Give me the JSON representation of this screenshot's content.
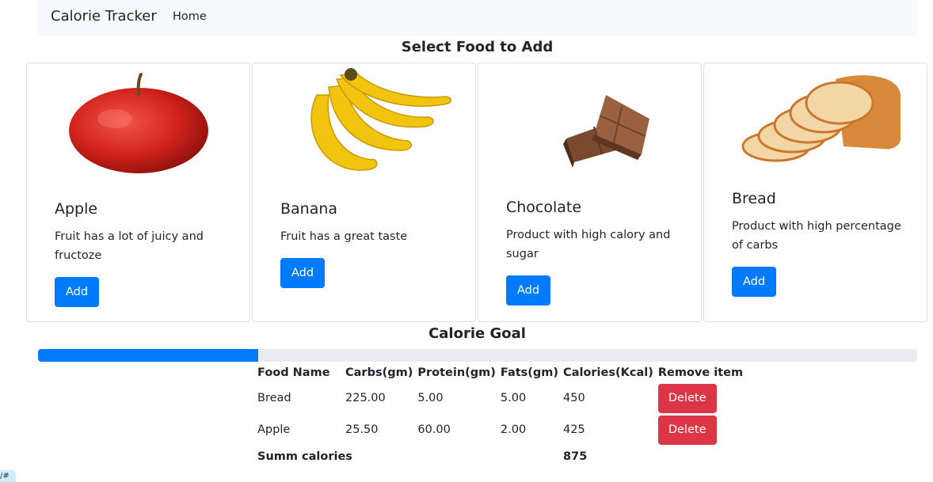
{
  "navbar": {
    "brand": "Calorie Tracker",
    "home": "Home"
  },
  "select_title": "Select Food to Add",
  "foods": [
    {
      "name": "Apple",
      "desc": "Fruit has a lot of juicy and fructoze",
      "add": "Add",
      "icon": "apple-image"
    },
    {
      "name": "Banana",
      "desc": "Fruit has a great taste",
      "add": "Add",
      "icon": "banana-image"
    },
    {
      "name": "Chocolate",
      "desc": "Product with high calory and sugar",
      "add": "Add",
      "icon": "chocolate-image"
    },
    {
      "name": "Bread",
      "desc": "Product with high percentage of carbs",
      "add": "Add",
      "icon": "bread-image"
    }
  ],
  "goal": {
    "title": "Calorie Goal",
    "progress_fraction": 0.25,
    "bar_color": "#007bff"
  },
  "table": {
    "headers": [
      "Food Name",
      "Carbs(gm)",
      "Protein(gm)",
      "Fats(gm)",
      "Calories(Kcal)",
      "Remove item"
    ],
    "rows": [
      {
        "name": "Bread",
        "carbs": "225.00",
        "protein": "5.00",
        "fats": "5.00",
        "calories": "450",
        "remove": "Delete"
      },
      {
        "name": "Apple",
        "carbs": "25.50",
        "protein": "60.00",
        "fats": "2.00",
        "calories": "425",
        "remove": "Delete"
      }
    ],
    "sum_label": "Summ calories",
    "sum_value": "875"
  },
  "corner_tag": "/#",
  "colors": {
    "primary": "#007bff",
    "danger": "#dc3545",
    "navbar_bg": "#f8f9fa"
  }
}
